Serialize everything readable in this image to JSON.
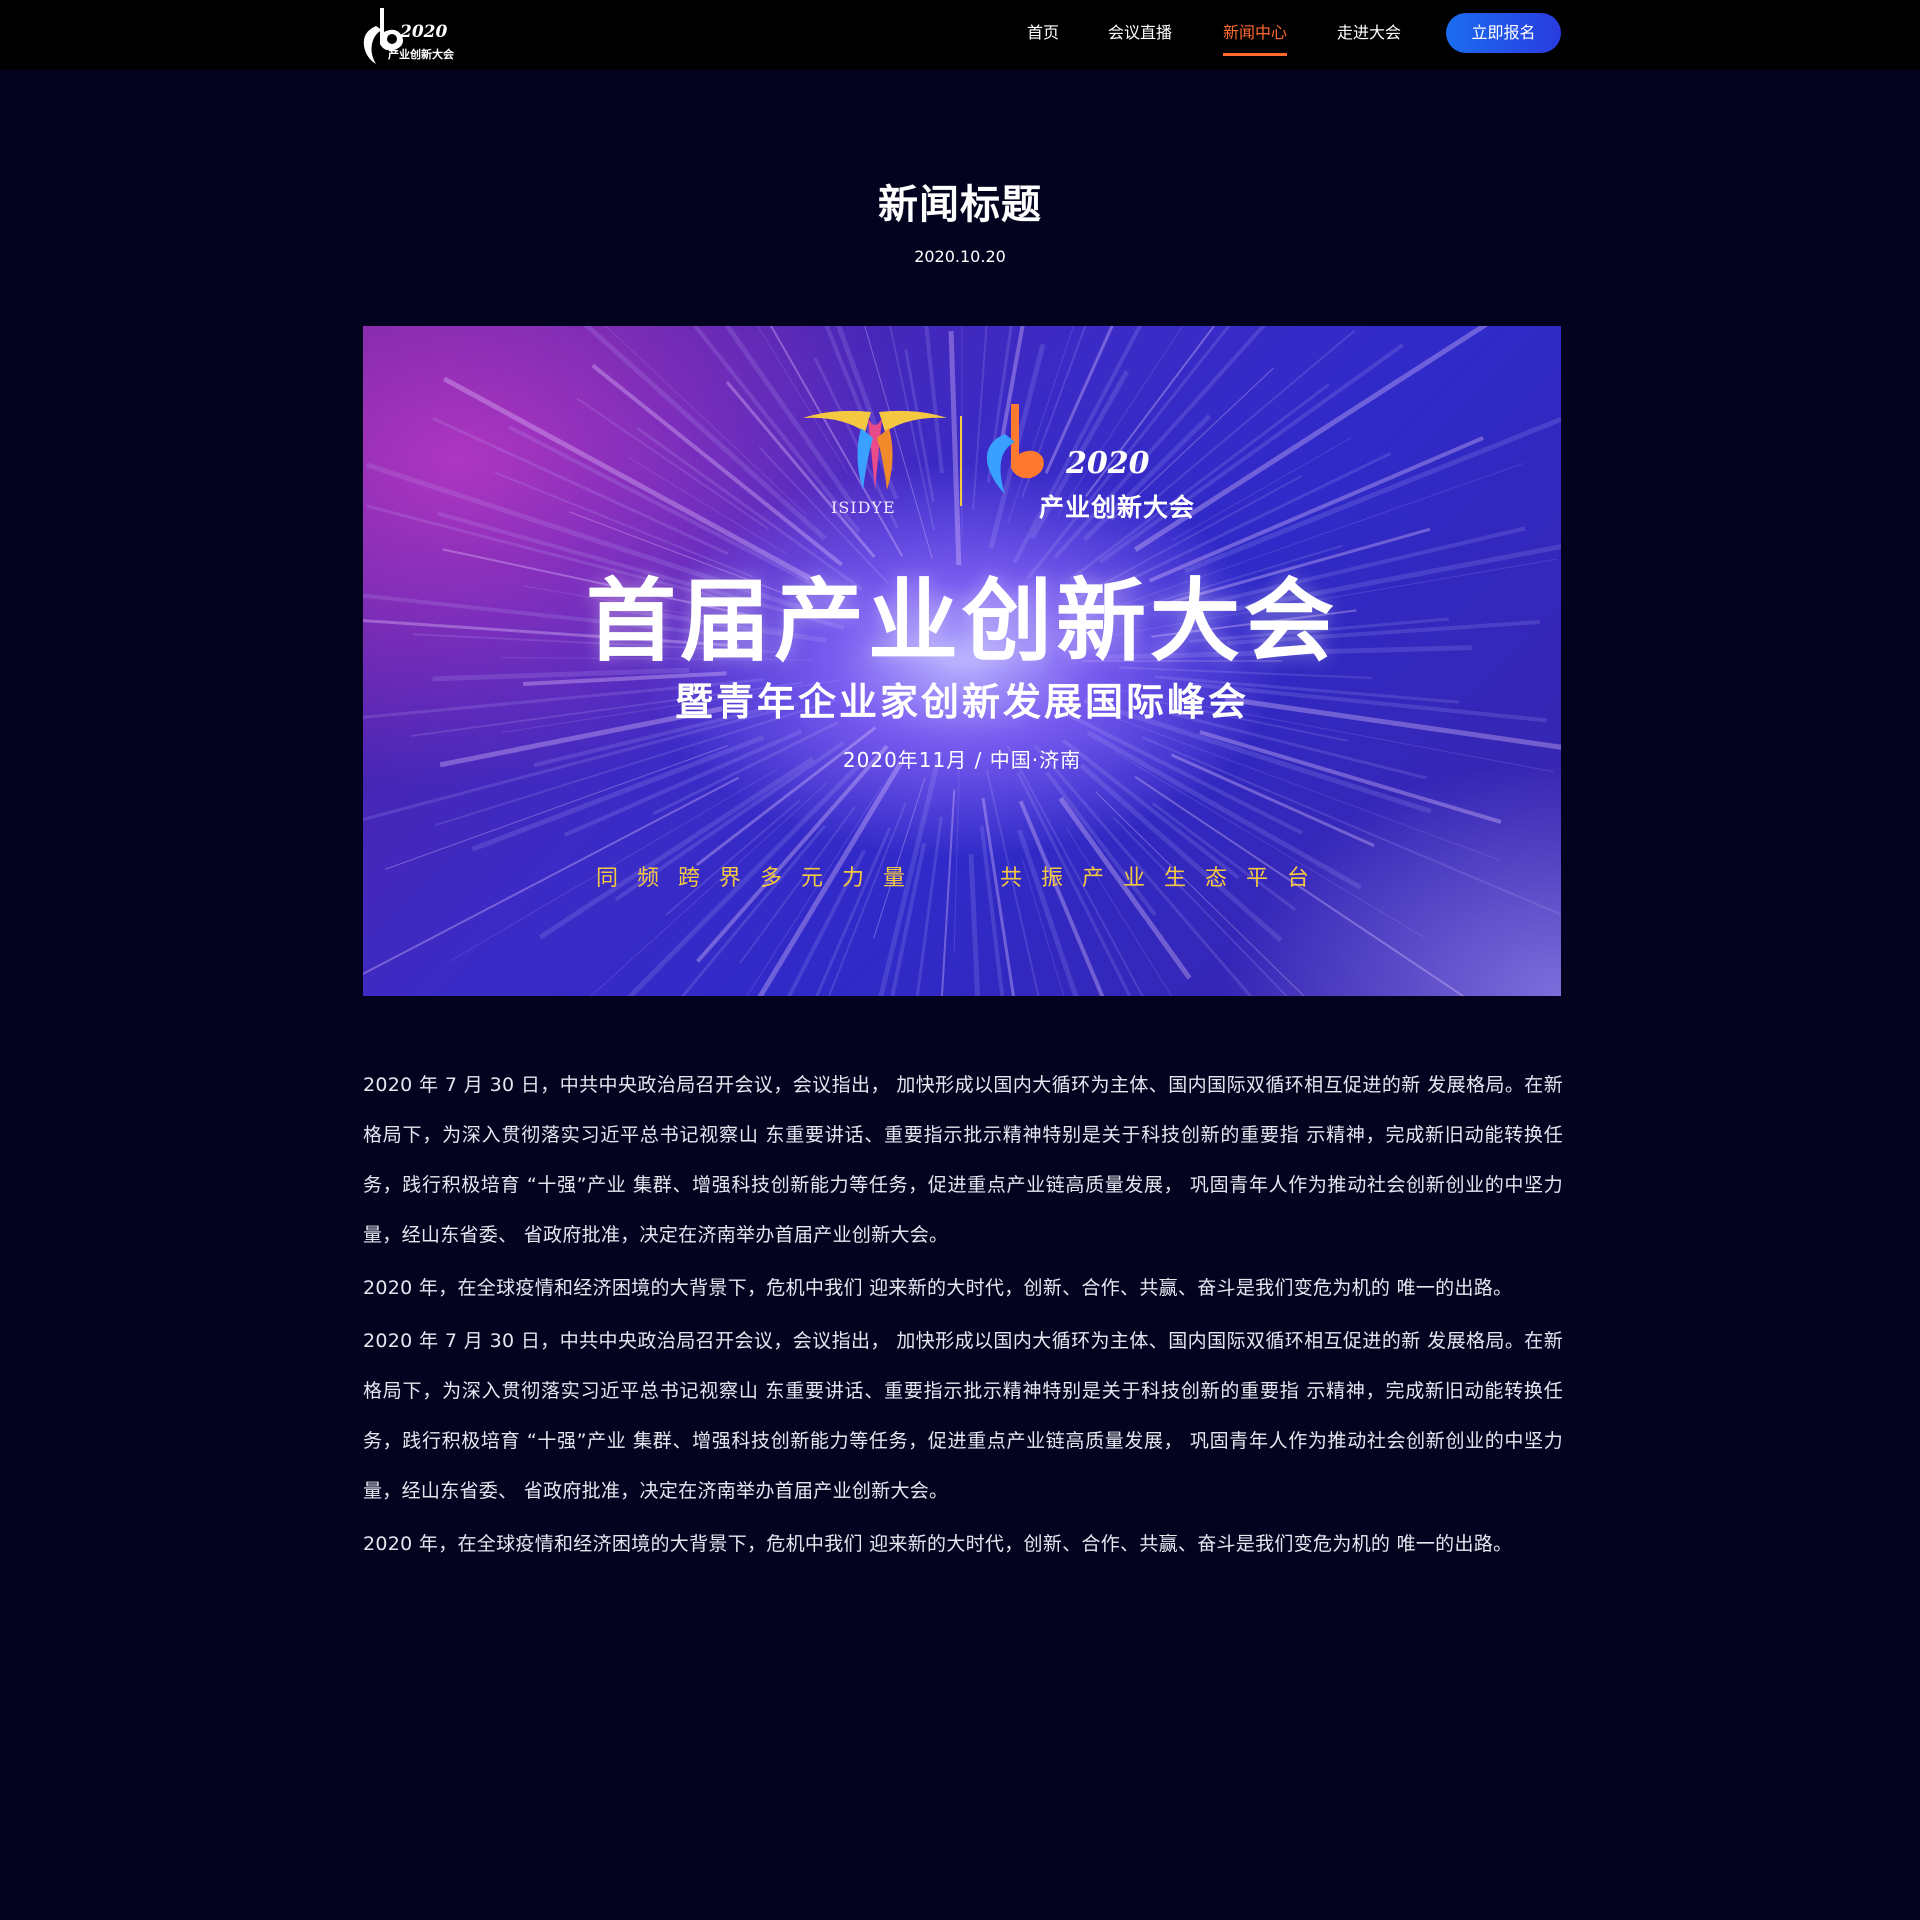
{
  "header": {
    "logo": {
      "year": "2020",
      "name": "产业创新大会"
    },
    "nav": [
      {
        "label": "首页"
      },
      {
        "label": "会议直播"
      },
      {
        "label": "新闻中心",
        "active": true
      },
      {
        "label": "走进大会"
      }
    ],
    "cta_label": "立即报名"
  },
  "article": {
    "title": "新闻标题",
    "date": "2020.10.20",
    "banner": {
      "partner_logo_text": "ISIDYE",
      "event_logo_year": "2020",
      "event_logo_name": "产业创新大会",
      "headline": "首届产业创新大会",
      "subheadline": "暨青年企业家创新发展国际峰会",
      "date_location": "2020年11月  / 中国·济南",
      "slogan_left": "同频跨界多元力量",
      "slogan_right": "共振产业生态平台"
    },
    "paragraphs": [
      "2020 年 7 月 30 日，中共中央政治局召开会议，会议指出， 加快形成以国内大循环为主体、国内国际双循环相互促进的新 发展格局。在新格局下，为深入贯彻落实习近平总书记视察山 东重要讲话、重要指示批示精神特别是关于科技创新的重要指 示精神，完成新旧动能转换任务，践行积极培育 “十强”产业 集群、增强科技创新能力等任务，促进重点产业链高质量发展， 巩固青年人作为推动社会创新创业的中坚力量，经山东省委、 省政府批准，决定在济南举办首届产业创新大会。",
      "2020 年，在全球疫情和经济困境的大背景下，危机中我们 迎来新的大时代，创新、合作、共赢、奋斗是我们变危为机的 唯一的出路。",
      "2020 年 7 月 30 日，中共中央政治局召开会议，会议指出， 加快形成以国内大循环为主体、国内国际双循环相互促进的新 发展格局。在新格局下，为深入贯彻落实习近平总书记视察山 东重要讲话、重要指示批示精神特别是关于科技创新的重要指 示精神，完成新旧动能转换任务，践行积极培育 “十强”产业 集群、增强科技创新能力等任务，促进重点产业链高质量发展， 巩固青年人作为推动社会创新创业的中坚力量，经山东省委、 省政府批准，决定在济南举办首届产业创新大会。",
      "2020 年，在全球疫情和经济困境的大背景下，危机中我们 迎来新的大时代，创新、合作、共赢、奋斗是我们变危为机的 唯一的出路。"
    ]
  },
  "colors": {
    "page_bg": "#03031f",
    "header_bg": "#000000",
    "active_nav": "#ff6a2e",
    "cta_gradient_start": "#1b6cf0",
    "cta_gradient_end": "#2a3be0",
    "slogan": "#f5c842"
  }
}
